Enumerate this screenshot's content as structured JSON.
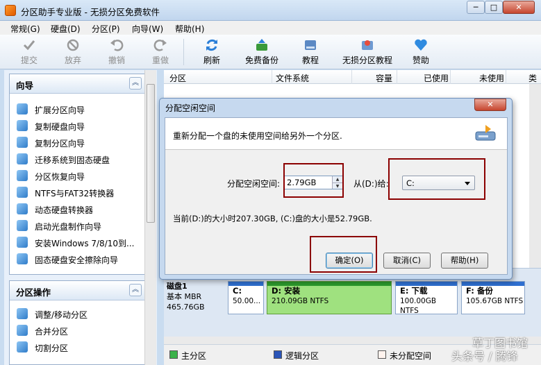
{
  "window": {
    "title": "分区助手专业版 - 无损分区免费软件",
    "min": "─",
    "max": "□",
    "close": "✕"
  },
  "menu": [
    "常规(G)",
    "硬盘(D)",
    "分区(P)",
    "向导(W)",
    "帮助(H)"
  ],
  "toolbar": {
    "commit": "提交",
    "discard": "放弃",
    "undo": "撤销",
    "redo": "重做",
    "refresh": "刷新",
    "backup": "免费备份",
    "tutorial": "教程",
    "lossless": "无损分区教程",
    "donate": "赞助"
  },
  "wizard_panel": {
    "title": "向导",
    "items": [
      "扩展分区向导",
      "复制硬盘向导",
      "复制分区向导",
      "迁移系统到固态硬盘",
      "分区恢复向导",
      "NTFS与FAT32转换器",
      "动态硬盘转换器",
      "启动光盘制作向导",
      "安装Windows 7/8/10到...",
      "固态硬盘安全擦除向导"
    ]
  },
  "partition_panel": {
    "title": "分区操作",
    "items": [
      "调整/移动分区",
      "合并分区",
      "切割分区"
    ]
  },
  "columns": [
    "分区",
    "文件系统",
    "容量",
    "已使用",
    "未使用",
    "类"
  ],
  "side_chars": [
    "逻",
    "逻",
    "逻"
  ],
  "disk_map": {
    "disk_name": "磁盘1",
    "disk_type": "基本 MBR",
    "disk_size": "465.76GB",
    "partitions": [
      {
        "name": "C:",
        "detail": "50.00..."
      },
      {
        "name": "D: 安装",
        "detail": "210.09GB NTFS"
      },
      {
        "name": "E: 下载",
        "detail": "100.00GB NTFS"
      },
      {
        "name": "F: 备份",
        "detail": "105.67GB NTFS"
      }
    ]
  },
  "legend": {
    "primary": "主分区",
    "logical": "逻辑分区",
    "unallocated": "未分配空间"
  },
  "watermark": "头条号 / 腾锋",
  "watermark2": "草丁图书馆",
  "dialog": {
    "title": "分配空闲空间",
    "close": "✕",
    "description": "重新分配一个盘的未使用空间给另外一个分区.",
    "size_label": "分配空闲空间:",
    "size_value": "2.79GB",
    "from_label": "从(D:)给:",
    "target": "C:",
    "info": "当前(D:)的大小时207.30GB, (C:)盘的大小是52.79GB.",
    "ok": "确定(O)",
    "cancel": "取消(C)",
    "help": "帮助(H)"
  }
}
